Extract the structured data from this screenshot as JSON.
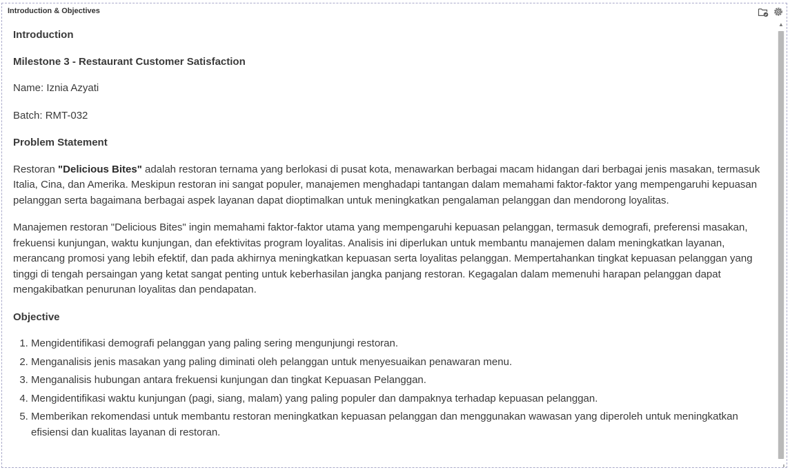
{
  "panel": {
    "title": "Introduction & Objectives"
  },
  "toolbar": {
    "icons": [
      "folder-check-icon",
      "gear-icon"
    ]
  },
  "content": {
    "h_intro": "Introduction",
    "h_milestone": "Milestone 3 - Restaurant Customer Satisfaction",
    "name_line": "Name: Iznia Azyati",
    "batch_line": "Batch: RMT-032",
    "h_problem": "Problem Statement",
    "problem_p1": {
      "prefix": "Restoran ",
      "bold": "\"Delicious Bites\"",
      "suffix": " adalah restoran ternama yang berlokasi di pusat kota, menawarkan berbagai macam hidangan dari berbagai jenis masakan, termasuk Italia, Cina, dan Amerika. Meskipun restoran ini sangat populer, manajemen menghadapi tantangan dalam memahami faktor-faktor yang mempengaruhi kepuasan pelanggan serta bagaimana berbagai aspek layanan dapat dioptimalkan untuk meningkatkan pengalaman pelanggan dan mendorong loyalitas."
    },
    "problem_p2": "Manajemen restoran \"Delicious Bites\" ingin memahami faktor-faktor utama yang mempengaruhi kepuasan pelanggan, termasuk demografi, preferensi masakan, frekuensi kunjungan, waktu kunjungan, dan efektivitas program loyalitas. Analisis ini diperlukan untuk membantu manajemen dalam meningkatkan layanan, merancang promosi yang lebih efektif, dan pada akhirnya meningkatkan kepuasan serta loyalitas pelanggan. Mempertahankan tingkat kepuasan pelanggan yang tinggi di tengah persaingan yang ketat sangat penting untuk keberhasilan jangka panjang restoran. Kegagalan dalam memenuhi harapan pelanggan dapat mengakibatkan penurunan loyalitas dan pendapatan.",
    "h_objective": "Objective",
    "objectives": [
      "Mengidentifikasi demografi pelanggan yang paling sering mengunjungi restoran.",
      "Menganalisis jenis masakan yang paling diminati oleh pelanggan untuk menyesuaikan penawaran menu.",
      "Menganalisis hubungan antara frekuensi kunjungan dan tingkat Kepuasan Pelanggan.",
      "Mengidentifikasi waktu kunjungan (pagi, siang, malam) yang paling populer dan dampaknya terhadap kepuasan pelanggan.",
      "Memberikan rekomendasi untuk membantu restoran meningkatkan kepuasan pelanggan dan menggunakan wawasan yang diperoleh untuk meningkatkan efisiensi dan kualitas layanan di restoran."
    ]
  },
  "colors": {
    "text": "#3a3a3a",
    "border": "#a9a9c9",
    "scroll_thumb": "#b9b9b9"
  }
}
